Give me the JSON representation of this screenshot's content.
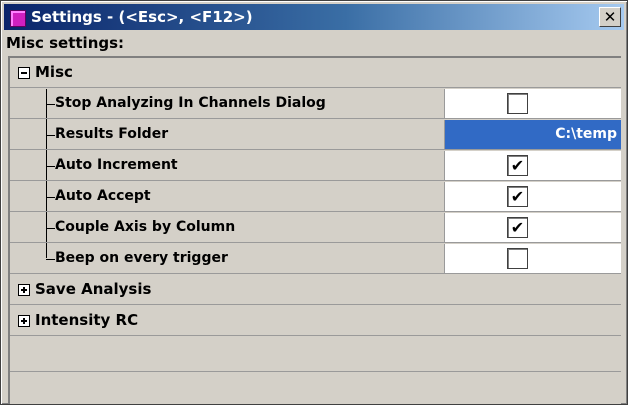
{
  "window": {
    "title": "Settings - (<Esc>, <F12>)",
    "close_label": "✕"
  },
  "section_label": "Misc settings:",
  "categories": [
    {
      "label": "Misc",
      "expanded": true,
      "properties": [
        {
          "label": "Stop Analyzing In Channels Dialog",
          "type": "checkbox",
          "checked": false,
          "mark": ""
        },
        {
          "label": "Results Folder",
          "type": "text",
          "value": "C:\\temp",
          "selected": true
        },
        {
          "label": "Auto Increment",
          "type": "checkbox",
          "checked": true,
          "mark": "✔"
        },
        {
          "label": "Auto Accept",
          "type": "checkbox",
          "checked": true,
          "mark": "✔"
        },
        {
          "label": "Couple Axis by Column",
          "type": "checkbox",
          "checked": true,
          "mark": "✔"
        },
        {
          "label": "Beep on every trigger",
          "type": "checkbox",
          "checked": false,
          "mark": ""
        }
      ]
    },
    {
      "label": "Save Analysis",
      "expanded": false
    },
    {
      "label": "Intensity RC",
      "expanded": false
    }
  ],
  "colors": {
    "title_gradient_start": "#0a246a",
    "title_gradient_end": "#a6caf0",
    "selection": "#316ac5",
    "window_face": "#d4d0c8"
  }
}
